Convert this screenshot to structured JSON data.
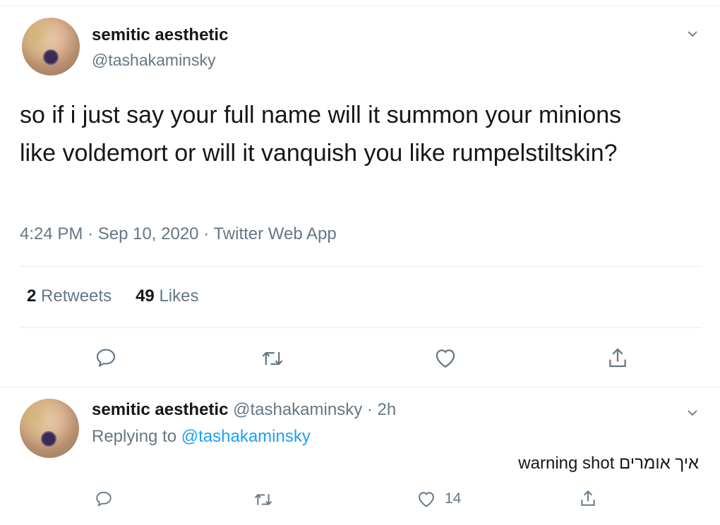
{
  "tweet": {
    "display_name": "semitic aesthetic",
    "handle": "@tashakaminsky",
    "text": "so if i just say your full name will it summon your minions like voldemort or will it vanquish you like rumpelstiltskin?",
    "time": "4:24 PM",
    "date": "Sep 10, 2020",
    "source": "Twitter Web App",
    "retweets_count": "2",
    "retweets_label": "Retweets",
    "likes_count": "49",
    "likes_label": "Likes",
    "separator": "·"
  },
  "reply": {
    "display_name": "semitic aesthetic",
    "handle": "@tashakaminsky",
    "separator": "·",
    "age": "2h",
    "replying_label": "Replying to",
    "replying_to": "@tashakaminsky",
    "text": "איך אומרים warning shot",
    "like_count": "14"
  },
  "icons": {
    "avatar": "avatar",
    "caret": "chevron-down-icon",
    "reply": "reply-icon",
    "retweet": "retweet-icon",
    "like": "heart-icon",
    "share": "share-icon"
  },
  "colors": {
    "text": "#14171a",
    "secondary": "#657786",
    "link": "#1da1f2",
    "divider": "#e6ecf0"
  }
}
